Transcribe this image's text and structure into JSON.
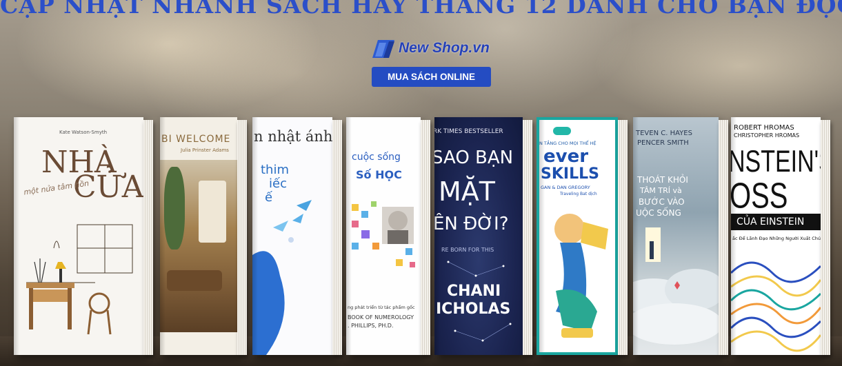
{
  "banner": {
    "title": "CẬP NHẬT NHANH SÁCH HAY THÁNG 12 DÀNH CHO BẠN ĐỌC",
    "logo_text": "New Shop.vn",
    "cta_label": "MUA SÁCH ONLINE"
  },
  "books": [
    {
      "author": "Kate Watson-Smyth",
      "title_line1": "NHÀ",
      "title_line2": "CỬA",
      "subtitle": "một nửa tâm hồn"
    },
    {
      "title": "BI WELCOME",
      "author": "Julia Prinster Adams"
    },
    {
      "author": "n nhật ánh",
      "line1": "thim",
      "line2": "iếc",
      "line3": "ế"
    },
    {
      "line1": "cuộc sống",
      "line2": "Số HỌC",
      "bottom1": "ng phát triển từ tác phẩm gốc",
      "bottom2": "BOOK OF NUMEROLOGY",
      "bottom3": ". PHILLIPS, PH.D."
    },
    {
      "top": "RK TIMES BESTSELLER",
      "line1": "SAO BẠN",
      "line2": "MẶT",
      "line3": "ÊN ĐỜI?",
      "tagline": "RE BORN FOR THIS",
      "author1": "CHANI",
      "author2": "ICHOLAS"
    },
    {
      "top": "N TẮNG CHO MỌI THẾ HỆ",
      "line1": "ever",
      "line2": "SKILLS",
      "authors": "GAN & DAN GREGORY",
      "translator": "Traveling Bat dịch"
    },
    {
      "authors1": "TEVEN C. HAYES",
      "authors2": "PENCER SMITH",
      "line1": "THOÁT KHỎI",
      "line2": "TÂM TRÍ và",
      "line3": "BƯỚC VÀO",
      "line4": "UỘC SỐNG"
    },
    {
      "authors1": "ROBERT HROMAS",
      "authors2": "CHRISTOPHER HROMAS",
      "line1": "NSTEIN'S",
      "line2": "OSS",
      "band": "CỦA EINSTEIN",
      "subtitle": "ắc Để Lãnh Đạo Những Người Xuất Chúng"
    }
  ]
}
